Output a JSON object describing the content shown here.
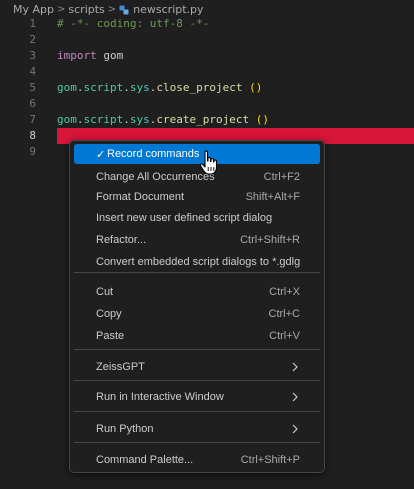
{
  "breadcrumb": {
    "items": [
      "My App",
      "scripts",
      "newscript.py"
    ],
    "separator": ">"
  },
  "editor": {
    "active_line": 8,
    "lines": [
      {
        "number": "1",
        "tokens": [
          {
            "text": "# -*- coding: utf-8 -*-",
            "kind": "comment"
          }
        ]
      },
      {
        "number": "2",
        "tokens": []
      },
      {
        "number": "3",
        "tokens": [
          {
            "text": "import",
            "kind": "kw"
          },
          {
            "text": " gom",
            "kind": "plain"
          }
        ]
      },
      {
        "number": "4",
        "tokens": []
      },
      {
        "number": "5",
        "tokens": [
          {
            "text": "gom",
            "kind": "ident"
          },
          {
            "text": ".",
            "kind": "plain"
          },
          {
            "text": "script",
            "kind": "ident"
          },
          {
            "text": ".",
            "kind": "plain"
          },
          {
            "text": "sys",
            "kind": "ident"
          },
          {
            "text": ".",
            "kind": "plain"
          },
          {
            "text": "close_project",
            "kind": "fn"
          },
          {
            "text": " ",
            "kind": "plain"
          },
          {
            "text": "()",
            "kind": "paren"
          }
        ]
      },
      {
        "number": "6",
        "tokens": []
      },
      {
        "number": "7",
        "tokens": [
          {
            "text": "gom",
            "kind": "ident"
          },
          {
            "text": ".",
            "kind": "plain"
          },
          {
            "text": "script",
            "kind": "ident"
          },
          {
            "text": ".",
            "kind": "plain"
          },
          {
            "text": "sys",
            "kind": "ident"
          },
          {
            "text": ".",
            "kind": "plain"
          },
          {
            "text": "create_project",
            "kind": "fn"
          },
          {
            "text": " ",
            "kind": "plain"
          },
          {
            "text": "()",
            "kind": "paren"
          }
        ]
      },
      {
        "number": "8",
        "tokens": []
      },
      {
        "number": "9",
        "tokens": []
      }
    ]
  },
  "context_menu": {
    "items": [
      {
        "label": "Record commands",
        "checkmark": "✓",
        "shortcut": "",
        "selected": true
      },
      {
        "label": "Change All Occurrences",
        "shortcut": "Ctrl+F2"
      },
      {
        "label": "Format Document",
        "shortcut": "Shift+Alt+F"
      },
      {
        "label": "Insert new user defined script dialog",
        "shortcut": ""
      },
      {
        "label": "Refactor...",
        "shortcut": "Ctrl+Shift+R"
      },
      {
        "label": "Convert embedded script dialogs to *.gdlg",
        "shortcut": ""
      },
      {
        "label": "Cut",
        "shortcut": "Ctrl+X"
      },
      {
        "label": "Copy",
        "shortcut": "Ctrl+C"
      },
      {
        "label": "Paste",
        "shortcut": "Ctrl+V"
      },
      {
        "label": "ZeissGPT",
        "submenu": true
      },
      {
        "label": "Run in Interactive Window",
        "submenu": true
      },
      {
        "label": "Run Python",
        "submenu": true
      },
      {
        "label": "Command Palette...",
        "shortcut": "Ctrl+Shift+P"
      }
    ]
  },
  "colors": {
    "background": "#1f1f1f",
    "highlight_line": "#d7163a",
    "menu_selection": "#0078d4",
    "comment": "#6a9955",
    "keyword": "#c586c0",
    "identifier": "#4ec9b0",
    "function": "#dcdcaa",
    "paren": "#ffd700"
  },
  "icons": {
    "file": "python-file-icon",
    "submenu": "chevron-right-icon",
    "pointer": "hand-pointer-icon"
  }
}
